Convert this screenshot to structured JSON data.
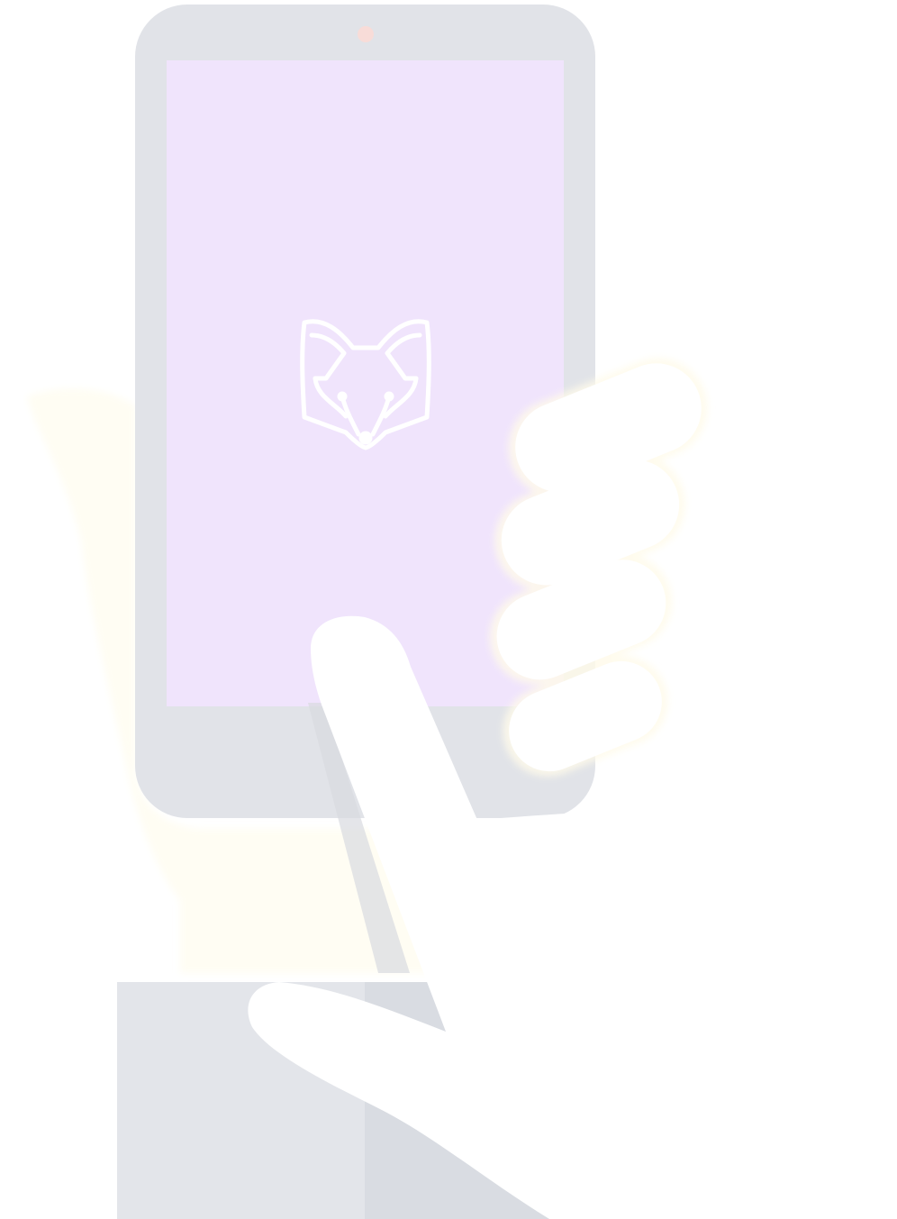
{
  "illustration": {
    "subject": "hand-holding-phone",
    "icons": {
      "logo": "fox-head-icon"
    },
    "colors": {
      "background": "#ffffff",
      "phone_body": "#e1e3e8",
      "phone_screen": "#f0e4fc",
      "camera": "#f8dcd8",
      "palm_glow": "#fffdf2",
      "sleeve": "#e3e5ea",
      "sleeve_shadow": "#d9dce2",
      "hand": "#ffffff",
      "finger_glow": "#fffbea",
      "fox_outline": "#ffffff"
    }
  }
}
